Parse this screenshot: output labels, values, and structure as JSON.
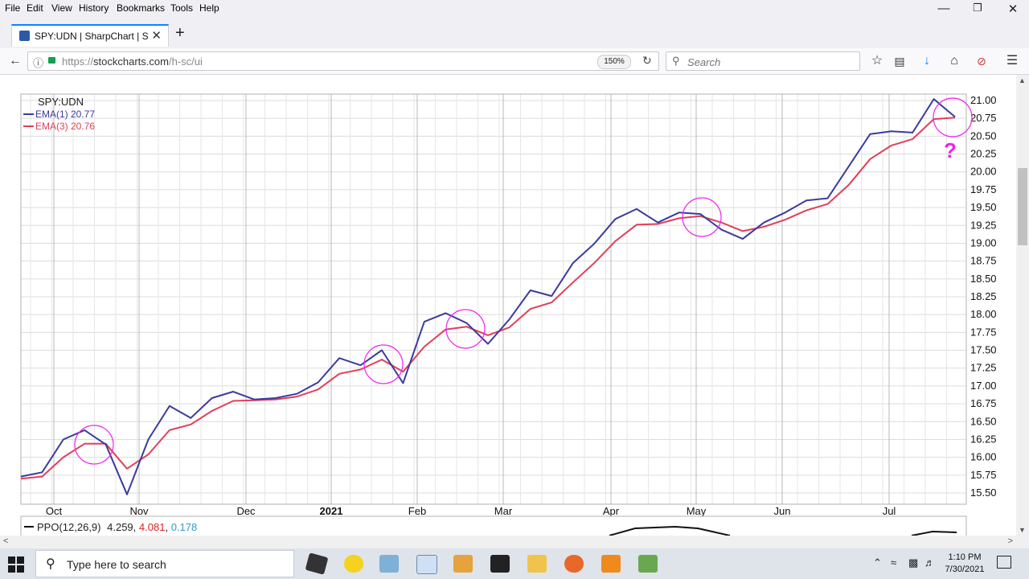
{
  "menu": [
    "File",
    "Edit",
    "View",
    "History",
    "Bookmarks",
    "Tools",
    "Help"
  ],
  "window_controls": {
    "minimize": "—",
    "restore": "❐",
    "close": "✕"
  },
  "tab": {
    "title": "SPY:UDN | SharpChart | Stoc",
    "close": "✕"
  },
  "new_tab": "+",
  "url": {
    "scheme": "https://",
    "host": "stockcharts.com",
    "path": "/h-sc/ui"
  },
  "zoom": "150%",
  "search": {
    "placeholder": "Search"
  },
  "chart": {
    "symbol": "SPY:UDN",
    "legend": [
      {
        "label": "EMA(1) 20.77",
        "color": "#3b3b9e"
      },
      {
        "label": "EMA(3) 20.76",
        "color": "#e0405a"
      }
    ],
    "question_mark": "?",
    "circle_color": "#ee22ee",
    "indicator": {
      "label": "PPO(12,26,9)",
      "v1": "4.259",
      "v2": "4.081",
      "v3": "0.178"
    }
  },
  "chart_data": {
    "type": "line",
    "x_ticks": [
      "Oct",
      "Nov",
      "Dec",
      "2021",
      "Feb",
      "Mar",
      "Apr",
      "May",
      "Jun",
      "Jul"
    ],
    "y_ticks": [
      "15.50",
      "15.75",
      "16.00",
      "16.25",
      "16.50",
      "16.75",
      "17.00",
      "17.25",
      "17.50",
      "17.75",
      "18.00",
      "18.25",
      "18.50",
      "18.75",
      "19.00",
      "19.25",
      "19.50",
      "19.75",
      "20.00",
      "20.25",
      "20.50",
      "20.75",
      "21.00"
    ],
    "ylim": [
      15.4,
      21.1
    ],
    "series": [
      {
        "name": "EMA(1) 20.77",
        "values": [
          15.73,
          15.79,
          16.25,
          16.38,
          16.18,
          15.48,
          16.25,
          16.72,
          16.55,
          16.83,
          16.92,
          16.81,
          16.83,
          16.89,
          17.05,
          17.39,
          17.29,
          17.5,
          17.04,
          17.9,
          18.02,
          17.88,
          17.59,
          17.93,
          18.34,
          18.26,
          18.72,
          18.99,
          19.34,
          19.48,
          19.29,
          19.43,
          19.41,
          19.19,
          19.06,
          19.29,
          19.43,
          19.6,
          19.63,
          20.08,
          20.53,
          20.57,
          20.55,
          21.02,
          20.77
        ]
      },
      {
        "name": "EMA(3) 20.76",
        "values": [
          15.7,
          15.73,
          16.0,
          16.19,
          16.19,
          15.84,
          16.04,
          16.38,
          16.46,
          16.65,
          16.79,
          16.8,
          16.81,
          16.85,
          16.95,
          17.17,
          17.23,
          17.37,
          17.2,
          17.55,
          17.79,
          17.83,
          17.71,
          17.82,
          18.08,
          18.17,
          18.45,
          18.72,
          19.03,
          19.26,
          19.27,
          19.35,
          19.38,
          19.29,
          19.17,
          19.23,
          19.33,
          19.46,
          19.55,
          19.82,
          20.18,
          20.37,
          20.46,
          20.74,
          20.76
        ]
      }
    ]
  },
  "taskbar": {
    "search_placeholder": "Type here to search",
    "time": "1:10 PM",
    "date": "7/30/2021"
  }
}
